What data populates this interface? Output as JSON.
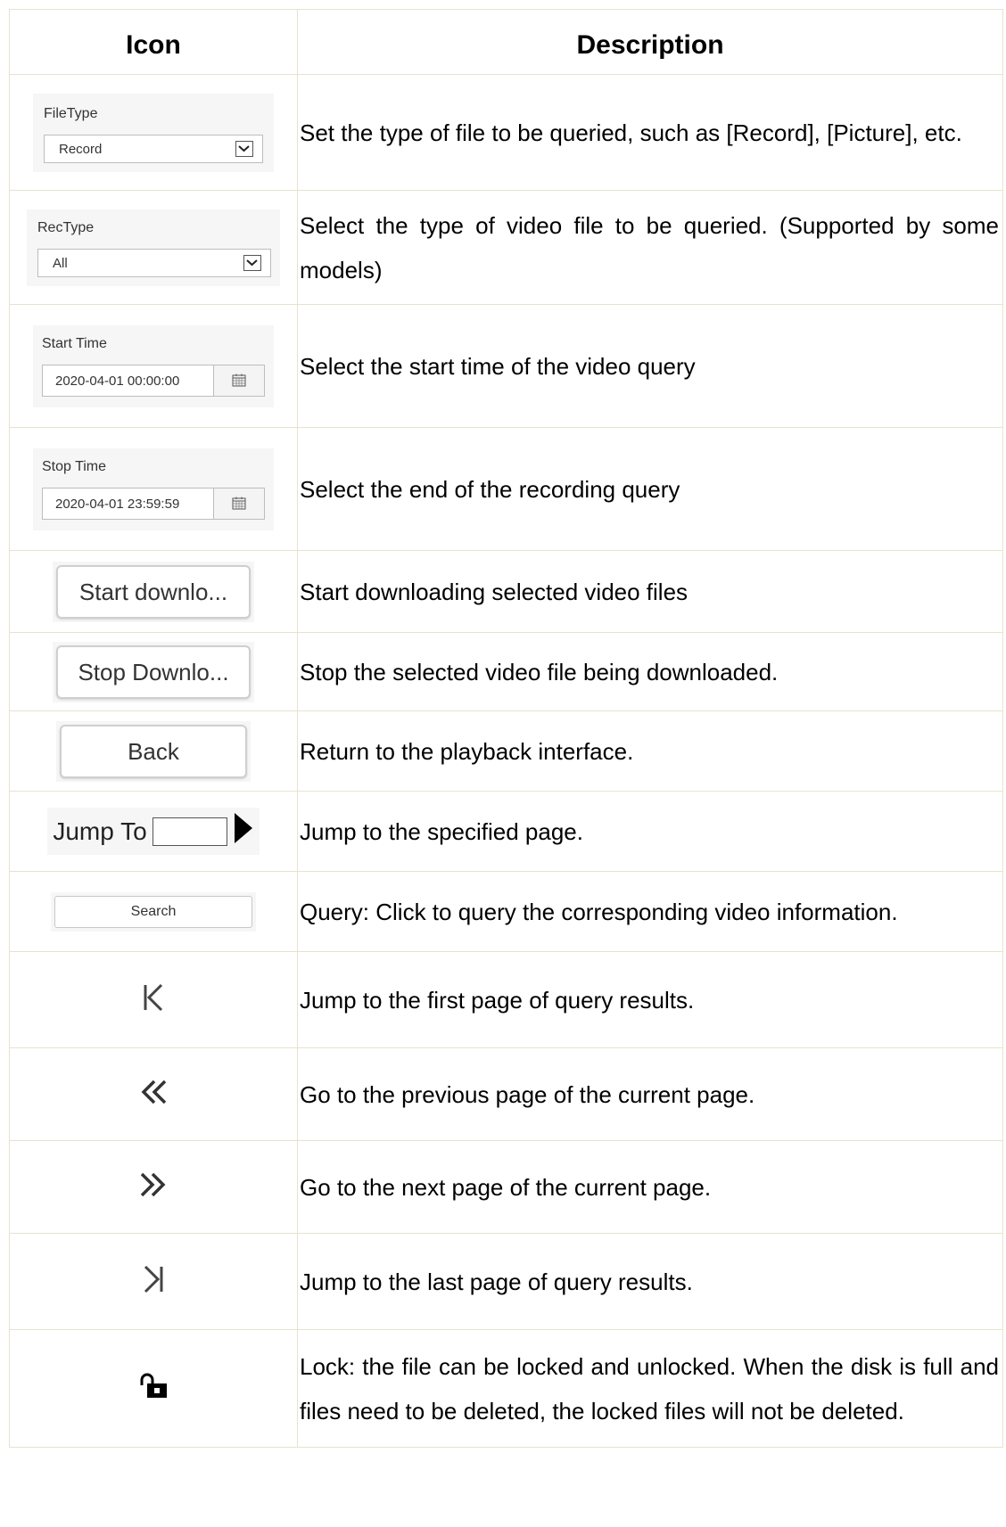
{
  "header": {
    "icon_col": "Icon",
    "desc_col": "Description"
  },
  "rows": [
    {
      "icon_label": "FileType",
      "icon_value": "Record",
      "description": "Set the type of file to be queried, such as [Record], [Picture], etc."
    },
    {
      "icon_label": "RecType",
      "icon_value": "All",
      "description": "Select the type of video file to be queried. (Supported by some models)"
    },
    {
      "icon_label": "Start Time",
      "icon_value": "2020-04-01 00:00:00",
      "description": "Select the start time of the video query"
    },
    {
      "icon_label": "Stop Time",
      "icon_value": "2020-04-01 23:59:59",
      "description": "Select the end of the recording query"
    },
    {
      "icon_label": "Start downlo...",
      "description": "Start downloading selected video files"
    },
    {
      "icon_label": "Stop Downlo...",
      "description": "Stop the selected video file being downloaded."
    },
    {
      "icon_label": "Back",
      "description": "Return to the playback interface."
    },
    {
      "icon_label": "Jump To",
      "description": "Jump to the specified page."
    },
    {
      "icon_label": "Search",
      "description": "Query: Click to query the corresponding video information."
    },
    {
      "icon_name": "first-page-icon",
      "description": "Jump to the first page of query results."
    },
    {
      "icon_name": "previous-page-icon",
      "description": "Go to the previous page of the current page."
    },
    {
      "icon_name": "next-page-icon",
      "description": "Go to the next page of the current page."
    },
    {
      "icon_name": "last-page-icon",
      "description": "Jump to the last page of query results."
    },
    {
      "icon_name": "lock-icon",
      "description": "Lock: the file can be locked and unlocked. When the disk is full and files need to be deleted, the locked files will not be deleted."
    }
  ]
}
